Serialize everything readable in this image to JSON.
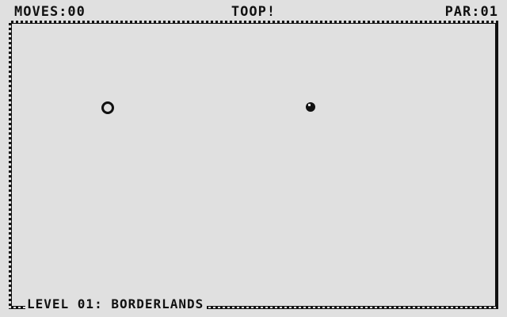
{
  "hud": {
    "moves_label": "MOVES:",
    "moves_value": "00",
    "title": "TOOP!",
    "par_label": "PAR:",
    "par_value": "01"
  },
  "level": {
    "label": "LEVEL 01: BORDERLANDS"
  },
  "objects": {
    "hole_icon": "hole-ring-icon",
    "ball_icon": "ball-icon"
  },
  "colors": {
    "background": "#e0e0e0",
    "foreground": "#111111"
  }
}
